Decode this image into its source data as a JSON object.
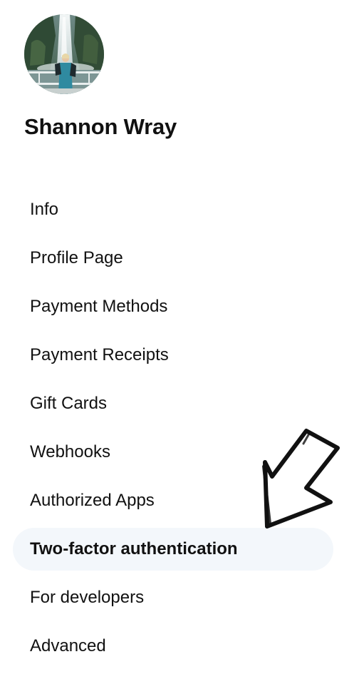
{
  "profile": {
    "avatar_icon": "user-photo-waterfall",
    "name": "Shannon Wray"
  },
  "nav": {
    "items": [
      {
        "label": "Info"
      },
      {
        "label": "Profile Page"
      },
      {
        "label": "Payment Methods"
      },
      {
        "label": "Payment Receipts"
      },
      {
        "label": "Gift Cards"
      },
      {
        "label": "Webhooks"
      },
      {
        "label": "Authorized Apps"
      },
      {
        "label": "Two-factor authentication",
        "active": true
      },
      {
        "label": "For developers"
      },
      {
        "label": "Advanced"
      }
    ],
    "active_background": "#f3f7fb"
  },
  "annotation": {
    "icon": "hand-drawn-arrow-icon",
    "points_to": "Two-factor authentication"
  }
}
